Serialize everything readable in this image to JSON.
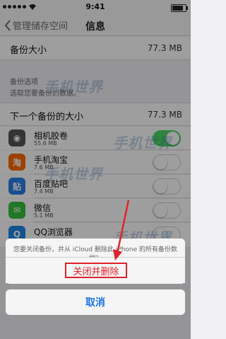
{
  "status": {
    "time": "9:41"
  },
  "nav": {
    "back_label": "管理储存空间",
    "title": "信息"
  },
  "backup_size": {
    "label": "备份大小",
    "value": "77.3 MB"
  },
  "backup_options": {
    "header": "备份选项",
    "subheader": "选取您要备份的数据。"
  },
  "next_backup": {
    "label": "下一个备份的大小",
    "value": "77.3 MB"
  },
  "apps": [
    {
      "name": "相机胶卷",
      "size": "55.6 MB",
      "icon": "camera-icon",
      "on": true,
      "color": "#555555",
      "glyph": "◉"
    },
    {
      "name": "手机淘宝",
      "size": "7.6 MB",
      "icon": "taobao-icon",
      "on": false,
      "color": "#ff6a00",
      "glyph": "淘"
    },
    {
      "name": "百度贴吧",
      "size": "7.4 MB",
      "icon": "tieba-icon",
      "on": false,
      "color": "#2a7ee6",
      "glyph": "贴"
    },
    {
      "name": "微信",
      "size": "5.1 MB",
      "icon": "wechat-icon",
      "on": false,
      "color": "#35c13d",
      "glyph": "✉"
    },
    {
      "name": "QQ浏览器",
      "size": "",
      "icon": "qq-browser-icon",
      "on": false,
      "color": "#1e88e5",
      "glyph": "Q"
    }
  ],
  "dialog": {
    "message": "您要关闭备份，并从 iCloud 删除此 iPhone 的所有备份数据？",
    "confirm_label": "关闭并删除",
    "cancel_label": "取消"
  },
  "watermark": "手机世界",
  "colors": {
    "accent": "#1a73e8",
    "destructive": "#e0232b",
    "toggle_on": "#4cd964"
  }
}
